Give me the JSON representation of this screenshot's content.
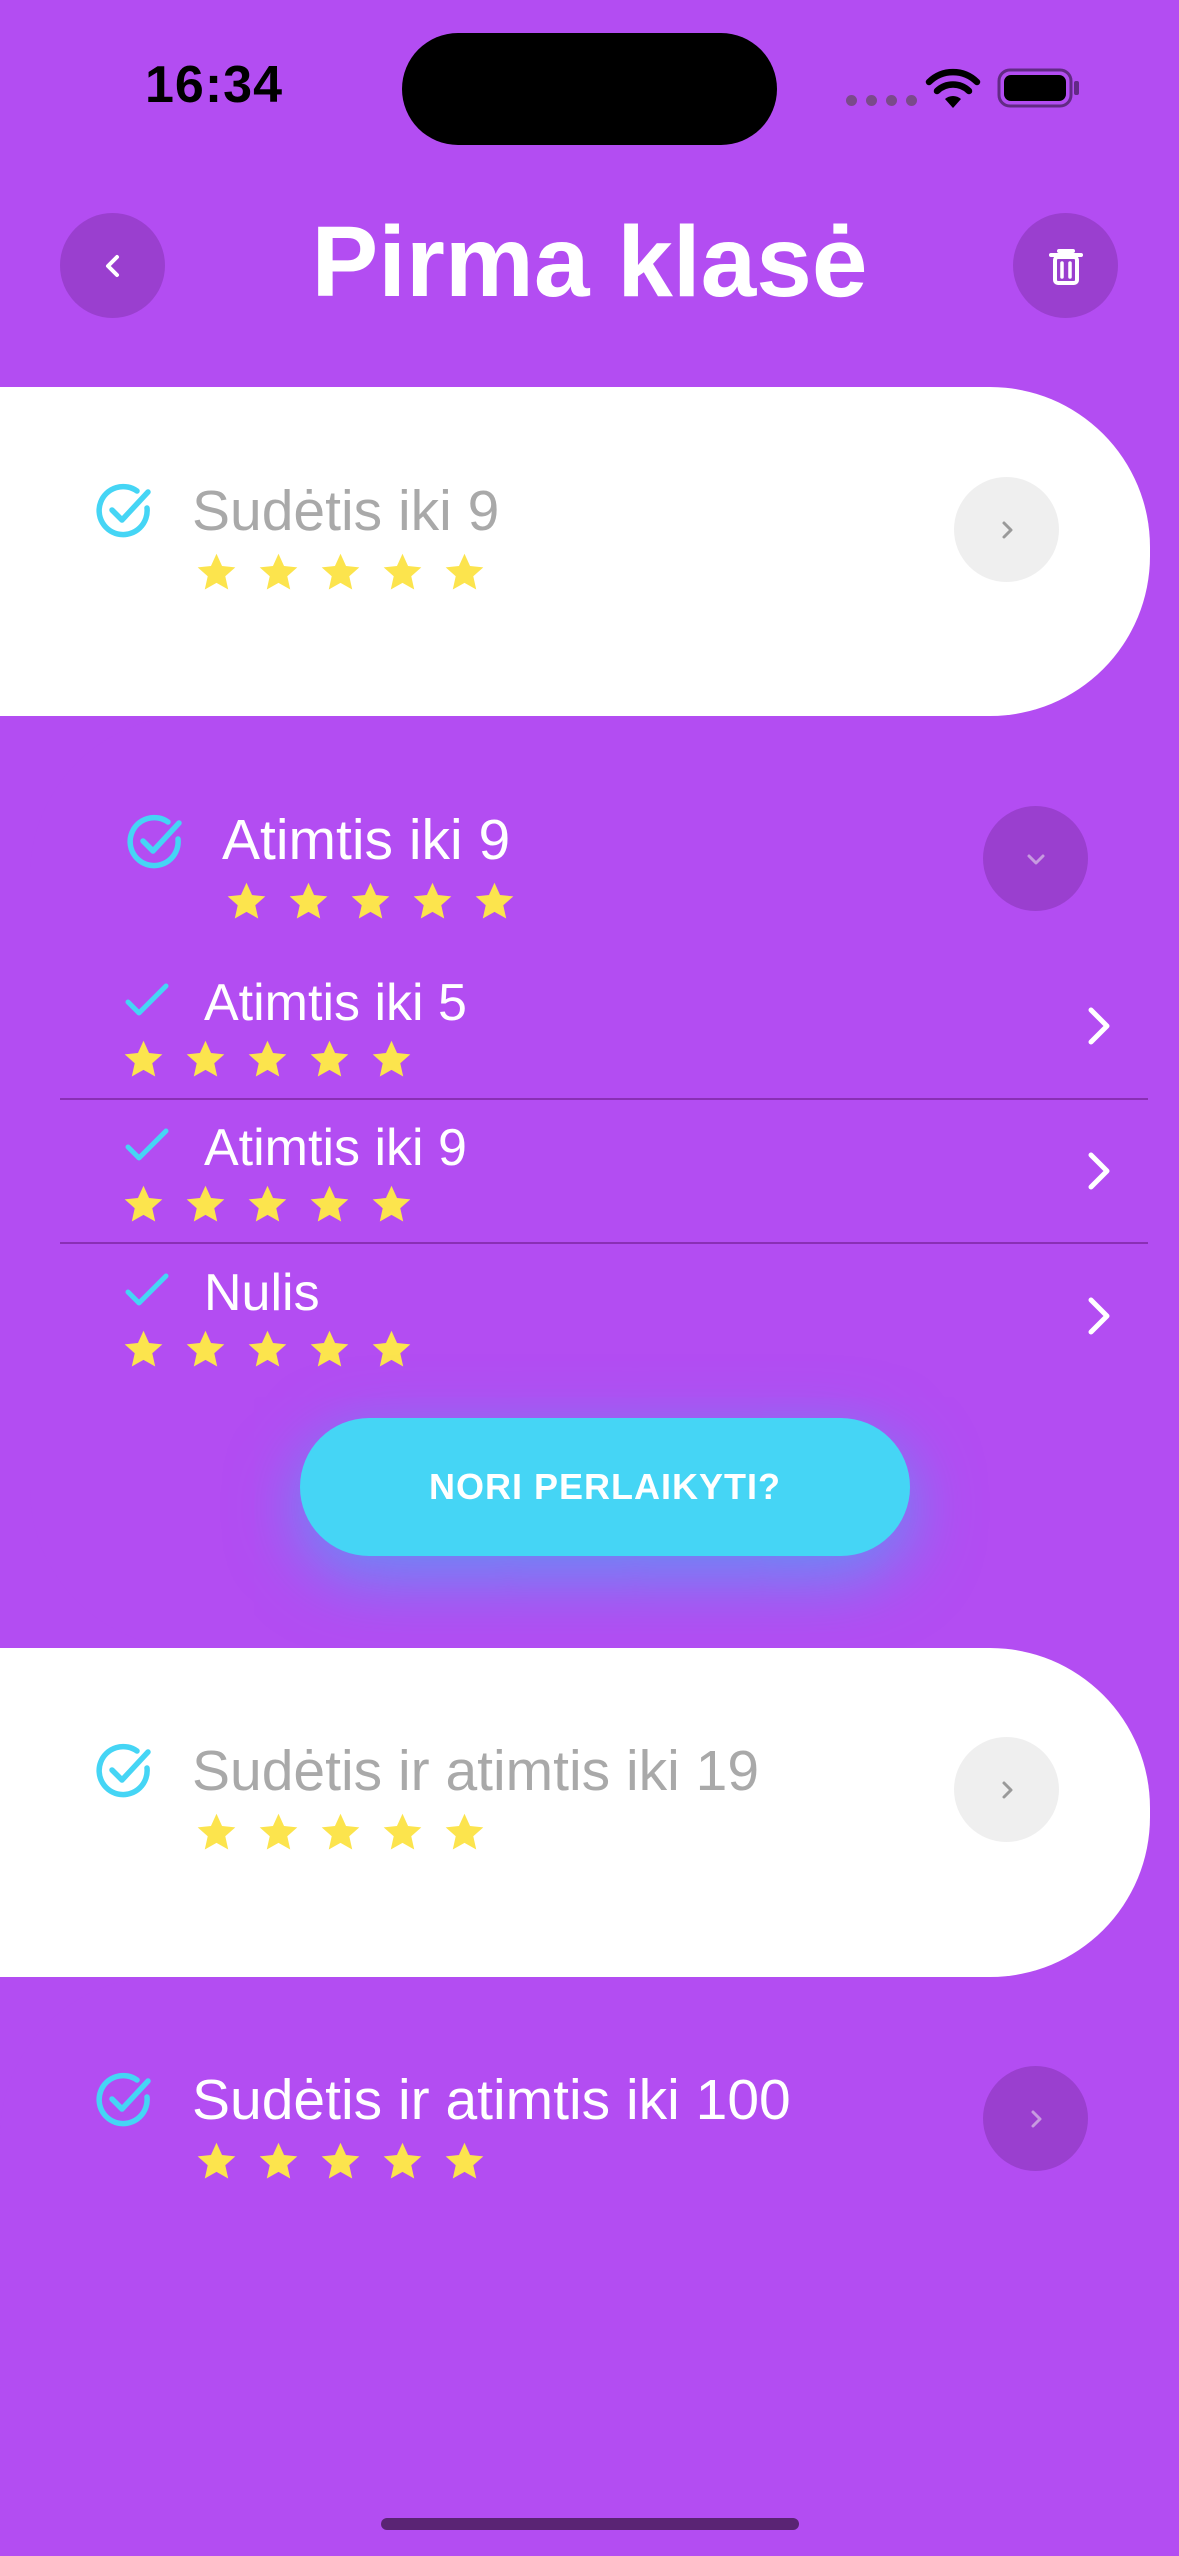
{
  "status_bar": {
    "time": "16:34"
  },
  "header": {
    "title": "Pirma klasė",
    "back_icon": "chevron-left-icon",
    "delete_icon": "trash-icon"
  },
  "sections": [
    {
      "title": "Sudėtis iki 9",
      "stars": 5,
      "completed": true,
      "expanded": false
    },
    {
      "title": "Atimtis iki 9",
      "stars": 5,
      "completed": true,
      "expanded": true,
      "lessons": [
        {
          "title": "Atimtis iki 5",
          "stars": 5,
          "completed": true
        },
        {
          "title": "Atimtis iki 9",
          "stars": 5,
          "completed": true
        },
        {
          "title": "Nulis",
          "stars": 5,
          "completed": true
        }
      ],
      "retake_label": "NORI PERLAIKYTI?"
    },
    {
      "title": "Sudėtis ir atimtis iki 19",
      "stars": 5,
      "completed": true,
      "expanded": false
    },
    {
      "title": "Sudėtis ir atimtis iki 100",
      "stars": 5,
      "completed": true,
      "expanded": false
    }
  ],
  "colors": {
    "background": "#B34DF2",
    "card": "#FFFFFF",
    "accent_cyan": "#45D5F5",
    "star": "#FCE44D",
    "button_dark": "#9A3FCF"
  }
}
